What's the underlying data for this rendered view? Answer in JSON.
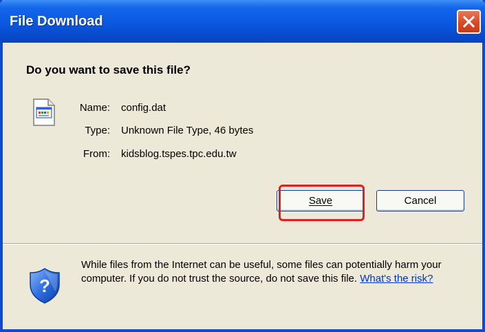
{
  "window": {
    "title": "File Download",
    "close_icon": "close-icon"
  },
  "dialog": {
    "question": "Do you want to save this file?",
    "file_icon": "document-icon",
    "fields": [
      {
        "label": "Name:",
        "value": "config.dat"
      },
      {
        "label": "Type:",
        "value": "Unknown File Type, 46 bytes"
      },
      {
        "label": "From:",
        "value": "kidsblog.tspes.tpc.edu.tw"
      }
    ],
    "buttons": {
      "save_label": "Save",
      "cancel_label": "Cancel"
    },
    "warning": {
      "icon": "shield-question-icon",
      "text": "While files from the Internet can be useful, some files can potentially harm your computer. If you do not trust the source, do not save this file.",
      "link_text": "What's the risk?"
    }
  },
  "annotation": {
    "highlight_color": "#e02020",
    "highlighted_element": "Save"
  },
  "colors": {
    "titlebar": "#0a58e0",
    "dialog_bg": "#ece9d8",
    "link": "#0033cc"
  }
}
